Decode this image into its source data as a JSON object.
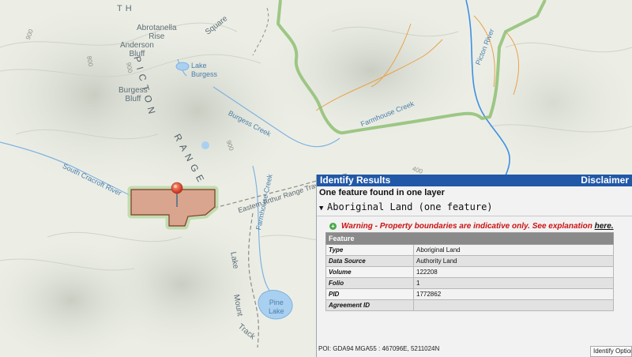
{
  "map": {
    "labels": {
      "th": "TH",
      "abrotanella_rise": "Abrotanella\nRise",
      "anderson_bluff": "Anderson\nBluff",
      "burgess_bluff": "Burgess\nBluff",
      "picton": "PICTON",
      "range": "RANGE",
      "lake_burgess": "Lake\nBurgess",
      "burgess_creek": "Burgess Creek",
      "farmhouse_creek": "Farmhouse Creek",
      "farmhouse_creek_2": "Farmhouse Creek",
      "picton_river": "Picton River",
      "south_cracroft": "South Cracroft River",
      "eastern_arthur": "Eastern Arthur Range Traverse",
      "lake": "Lake",
      "pine_lake": "Pine\nLake",
      "mount": "Mount",
      "track": "Track",
      "square": "Square",
      "contour_900a": "900",
      "contour_900b": "900",
      "contour_900c": "900",
      "contour_800": "800",
      "contour_400": "400"
    }
  },
  "identify": {
    "title": "Identify Results",
    "disclaimer": "Disclaimer",
    "summary": "One feature found in one layer",
    "layer_heading": "Aboriginal Land (one feature)",
    "warning_text": "Warning - Property boundaries are indicative only. See explanation ",
    "warning_link": "here.",
    "table_header": "Feature",
    "rows": [
      {
        "key": "Type",
        "value": "Aboriginal Land"
      },
      {
        "key": "Data Source",
        "value": "Authority Land"
      },
      {
        "key": "Volume",
        "value": "122208"
      },
      {
        "key": "Folio",
        "value": "1"
      },
      {
        "key": "PID",
        "value": "1772862"
      },
      {
        "key": "Agreement ID",
        "value": ""
      }
    ],
    "status": "POI: GDA94 MGA55 : 467096E, 5211024N",
    "identify_options": "Identify Options"
  },
  "colors": {
    "header_blue": "#2158a8",
    "parcel_fill": "#d9a58e",
    "parcel_stroke": "#7d3b2a",
    "reserve_boundary": "#8fbf73",
    "water": "#6fa9dd",
    "warning_red": "#c11111"
  }
}
